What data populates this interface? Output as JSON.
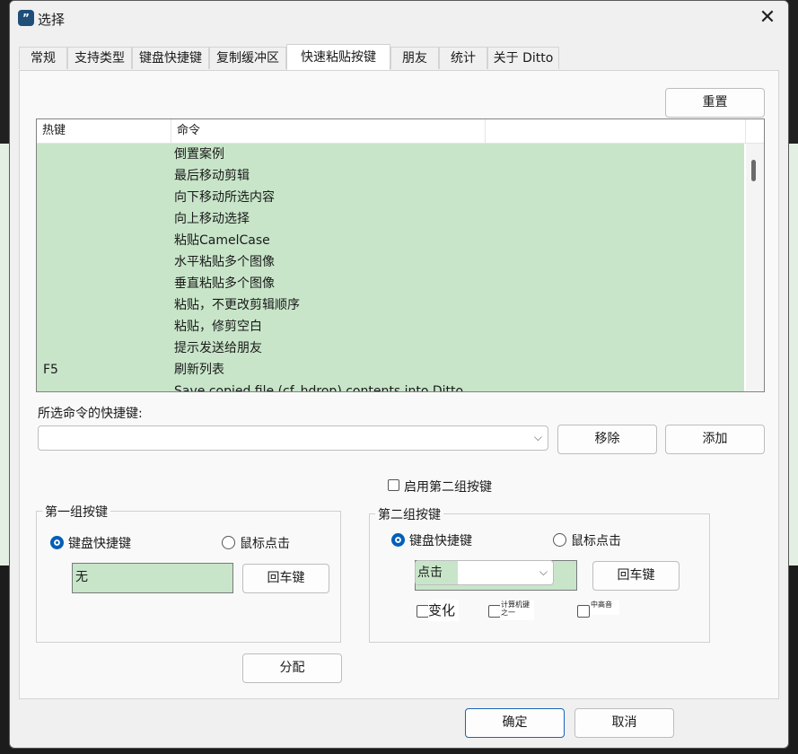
{
  "window": {
    "title": "选择",
    "close_glyph": "✕",
    "app_icon_glyph": "”"
  },
  "tabs": [
    {
      "label": "常规"
    },
    {
      "label": "支持类型"
    },
    {
      "label": "键盘快捷键"
    },
    {
      "label": "复制缓冲区"
    },
    {
      "label": "快速粘贴按键",
      "active": true
    },
    {
      "label": "朋友"
    },
    {
      "label": "统计"
    },
    {
      "label": "关于 Ditto"
    }
  ],
  "reset_button": "重置",
  "hotkey_list": {
    "columns": [
      "热键",
      "命令",
      ""
    ],
    "rows": [
      {
        "hotkey": "",
        "command": "倒置案例"
      },
      {
        "hotkey": "",
        "command": "最后移动剪辑"
      },
      {
        "hotkey": "",
        "command": "向下移动所选内容"
      },
      {
        "hotkey": "",
        "command": "向上移动选择"
      },
      {
        "hotkey": "",
        "command": "粘贴CamelCase"
      },
      {
        "hotkey": "",
        "command": "水平粘贴多个图像"
      },
      {
        "hotkey": "",
        "command": "垂直粘贴多个图像"
      },
      {
        "hotkey": "",
        "command": "粘贴，不更改剪辑顺序"
      },
      {
        "hotkey": "",
        "command": "粘贴，修剪空白"
      },
      {
        "hotkey": "",
        "command": "提示发送给朋友"
      },
      {
        "hotkey": "F5",
        "command": "刷新列表"
      },
      {
        "hotkey": "",
        "command": "Save copied file (cf_hdrop) contents into Ditto"
      }
    ]
  },
  "shortcut_section": {
    "label": "所选命令的快捷键:",
    "combo_value": "",
    "remove_button": "移除",
    "add_button": "添加"
  },
  "enable_second": {
    "label": "启用第二组按键",
    "checked": false
  },
  "group1": {
    "title": "第一组按键",
    "radio_keyboard": "键盘快捷键",
    "radio_mouse": "鼠标点击",
    "value": "无",
    "enter_button": "回车键"
  },
  "group2": {
    "title": "第二组按键",
    "radio_keyboard": "键盘快捷键",
    "radio_mouse": "鼠标点击",
    "combo_value": "点击",
    "enter_button": "回车键",
    "check_change": "变化",
    "check_computer_key": "计算机键之一",
    "check_mid_high": "中高音"
  },
  "assign_button": "分配",
  "ok_button": "确定",
  "cancel_button": "取消",
  "colors": {
    "accent": "#005fb8",
    "list_bg": "#c8e5c9",
    "primary_border": "#1a64b8"
  }
}
